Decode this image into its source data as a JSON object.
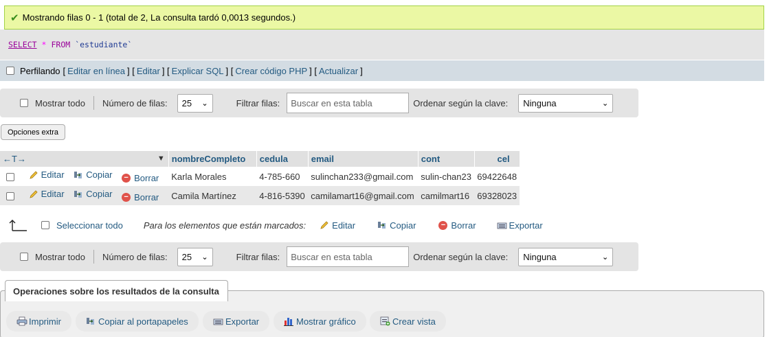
{
  "success_message": "Mostrando filas 0 - 1 (total de 2, La consulta tardó 0,0013 segundos.)",
  "sql": {
    "select": "SELECT",
    "star": "*",
    "from": "FROM",
    "table": "`estudiante`"
  },
  "profiling": {
    "label": "Perfilando",
    "links": [
      "Editar en línea",
      "Editar",
      "Explicar SQL",
      "Crear código PHP",
      "Actualizar"
    ]
  },
  "nav": {
    "show_all": "Mostrar todo",
    "rows_label": "Número de filas:",
    "rows_value": "25",
    "filter_label": "Filtrar filas:",
    "filter_placeholder": "Buscar en esta tabla",
    "sort_label": "Ordenar según la clave:",
    "sort_value": "Ninguna"
  },
  "extra_options": "Opciones extra",
  "table": {
    "arrows": "←T→",
    "columns": [
      "nombreCompleto",
      "cedula",
      "email",
      "cont",
      "cel"
    ],
    "actions": {
      "edit": "Editar",
      "copy": "Copiar",
      "delete": "Borrar"
    },
    "rows": [
      [
        "Karla Morales",
        "4-785-660",
        "sulinchan233@gmail.com",
        "sulin-chan23",
        "69422648"
      ],
      [
        "Camila Martínez",
        "4-816-5390",
        "camilamart16@gmail.com",
        "camilmart16",
        "69328023"
      ]
    ]
  },
  "bulk": {
    "select_all": "Seleccionar todo",
    "marked_label": "Para los elementos que están marcados:",
    "edit": "Editar",
    "copy": "Copiar",
    "delete": "Borrar",
    "export": "Exportar"
  },
  "operations": {
    "title": "Operaciones sobre los resultados de la consulta",
    "buttons": [
      "Imprimir",
      "Copiar al portapapeles",
      "Exportar",
      "Mostrar gráfico",
      "Crear vista"
    ]
  },
  "colors": {
    "success_bg": "#ebf8a4",
    "link": "#235a81",
    "delete": "#e0524a"
  }
}
